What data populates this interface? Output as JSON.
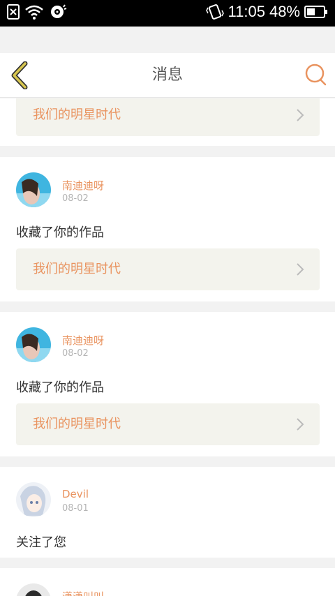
{
  "status_bar": {
    "time": "11:05",
    "battery": "48%",
    "icons": [
      "sim-missing-icon",
      "wifi-icon",
      "sync-icon",
      "vibrate-icon",
      "battery-icon"
    ]
  },
  "header": {
    "title": "消息",
    "back_icon": "chevron-left-icon",
    "search_icon": "search-icon"
  },
  "colors": {
    "accent": "#e9935f",
    "back_arrow": "#c6b33c",
    "card_bg": "#f3f3ed"
  },
  "messages": [
    {
      "work": "我们的明星时代"
    },
    {
      "user": "南迪迪呀",
      "date": "08-02",
      "action": "收藏了你的作品",
      "work": "我们的明星时代"
    },
    {
      "user": "南迪迪呀",
      "date": "08-02",
      "action": "收藏了你的作品",
      "work": "我们的明星时代"
    },
    {
      "user": "Devil",
      "date": "08-01",
      "action": "关注了您"
    },
    {
      "user": "潇潇叫叫"
    }
  ]
}
